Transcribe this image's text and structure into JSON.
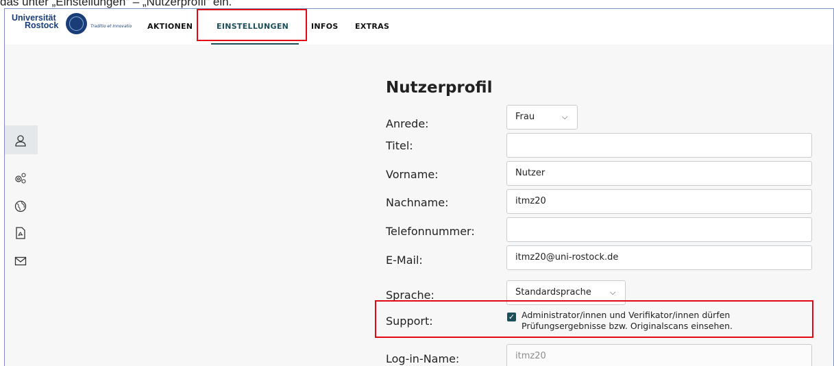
{
  "caption": "das unter „Einstellungen“ – „Nutzerprofil“ ein.",
  "logo": {
    "line1": "Universität",
    "line2": "Rostock",
    "motto": "Traditio et Innovatio"
  },
  "nav": {
    "items": [
      {
        "label": "AKTIONEN"
      },
      {
        "label": "EINSTELLUNGEN",
        "active": true
      },
      {
        "label": "INFOS"
      },
      {
        "label": "EXTRAS"
      }
    ]
  },
  "sidebar": {
    "icons": [
      "user-icon",
      "settings-gears-icon",
      "globe-icon",
      "pdf-icon",
      "mail-icon"
    ],
    "active": "user-icon"
  },
  "profile": {
    "heading": "Nutzerprofil",
    "anrede": {
      "label": "Anrede:",
      "value": "Frau"
    },
    "titel": {
      "label": "Titel:",
      "value": ""
    },
    "vorname": {
      "label": "Vorname:",
      "value": "Nutzer"
    },
    "nachname": {
      "label": "Nachname:",
      "value": "itmz20"
    },
    "telefon": {
      "label": "Telefonnummer:",
      "value": ""
    },
    "email": {
      "label": "E-Mail:",
      "value": "itmz20@uni-rostock.de"
    },
    "sprache": {
      "label": "Sprache:",
      "value": "Standardsprache"
    },
    "support": {
      "label": "Support:",
      "checked": true,
      "text_line1": "Administrator/innen und Verifikator/innen dürfen",
      "text_line2": "Prüfungsergebnisse bzw. Originalscans einsehen."
    },
    "login": {
      "label": "Log-in-Name:",
      "value": "itmz20"
    }
  },
  "colors": {
    "highlight": "#e30613",
    "accent": "#1d4e5a",
    "brand": "#1a3c77"
  }
}
